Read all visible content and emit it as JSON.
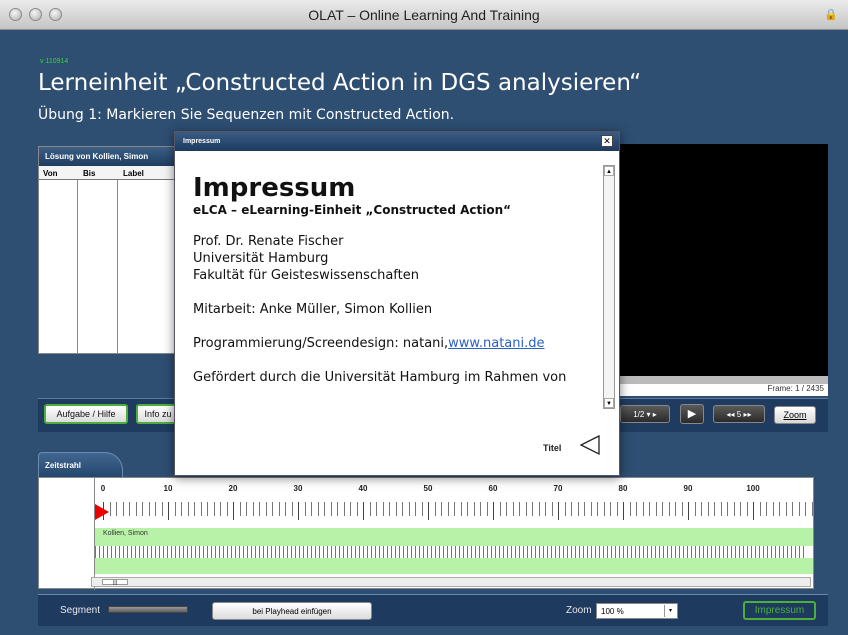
{
  "window": {
    "title": "OLAT – Online Learning And Training",
    "bg_color": "#2e4e72",
    "accent_green": "#4caf3b"
  },
  "page": {
    "version": "v 110914",
    "title": "Lerneinheit „Constructed Action in DGS analysieren“",
    "subtitle": "Übung 1: Markieren Sie Sequenzen mit Constructed Action."
  },
  "solution_panel": {
    "tab": "Lösung von Kollien, Simon",
    "columns": [
      "Von",
      "Bis",
      "Label"
    ]
  },
  "video": {
    "frame_label": "Frame: 1 / 2435"
  },
  "controls": {
    "task_help": "Aufgabe / Hilfe",
    "info": "Info zu",
    "speed": "1/2",
    "step_value": "5",
    "zoom": "Zoom"
  },
  "timeline": {
    "tab": "Zeitstrahl",
    "ruler": [
      "0",
      "10",
      "20",
      "30",
      "40",
      "50",
      "60",
      "70",
      "80",
      "90",
      "100"
    ],
    "track_name": "Kollien, Simon",
    "playhead_position": 0
  },
  "bottom": {
    "segment_label": "Segment",
    "insert_label": "bei Playhead einfügen",
    "zoom_label": "Zoom",
    "zoom_value": "100 %",
    "impressum": "Impressum"
  },
  "dialog": {
    "title": "Impressum",
    "heading": "Impressum",
    "subheading": "eLCA – eLearning-Einheit „Constructed Action“",
    "address": [
      "Prof. Dr. Renate Fischer",
      "Universität Hamburg",
      "Fakultät für Geisteswissenschaften"
    ],
    "staff": "Mitarbeit: Anke Müller, Simon Kollien",
    "programming_text": "Programmierung/Screendesign: natani,",
    "programming_link": "www.natani.de",
    "funding": "Gefördert durch die Universität Hamburg im Rahmen von",
    "titel": "Titel"
  }
}
